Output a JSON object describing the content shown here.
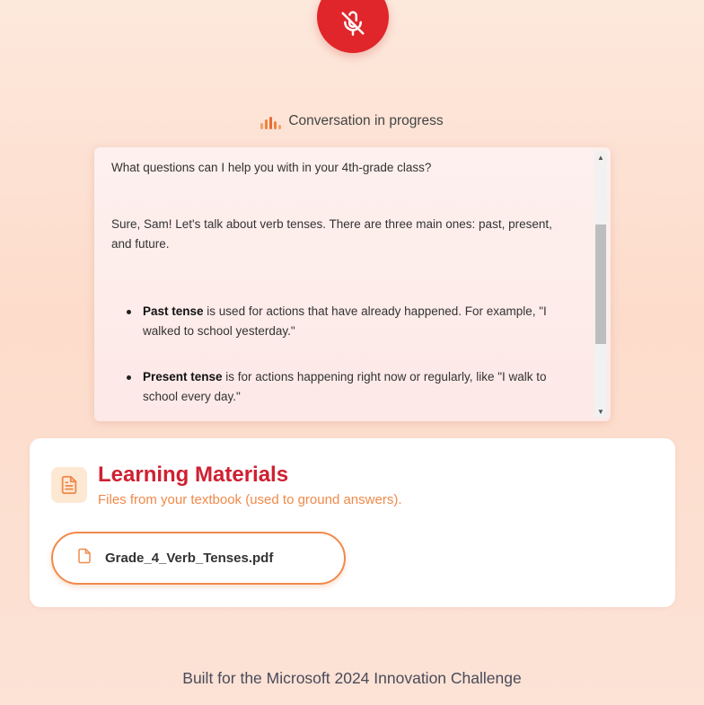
{
  "mic_button": {
    "icon": "microphone-off-icon",
    "color": "#e0262b"
  },
  "status": {
    "icon": "audio-bars-icon",
    "text": "Conversation in progress"
  },
  "chat": {
    "messages": [
      "What questions can I help you with in your 4th-grade class?",
      "Sure, Sam! Let's talk about verb tenses. There are three main ones: past, present, and future."
    ],
    "bullets": [
      {
        "term": "Past tense",
        "text": " is used for actions that have already happened. For example, \"I walked to school yesterday.\""
      },
      {
        "term": "Present tense",
        "text": " is for actions happening right now or regularly, like \"I walk to school every day.\""
      }
    ]
  },
  "materials": {
    "icon": "document-icon",
    "title": "Learning Materials",
    "subtitle": "Files from your textbook (used to ground answers).",
    "files": [
      {
        "icon": "file-icon",
        "name": "Grade_4_Verb_Tenses.pdf"
      }
    ]
  },
  "footer": {
    "text": "Built for the Microsoft 2024 Innovation Challenge"
  },
  "colors": {
    "accent": "#cf2032",
    "orange": "#f08a4c",
    "mic_red": "#e0262b"
  }
}
